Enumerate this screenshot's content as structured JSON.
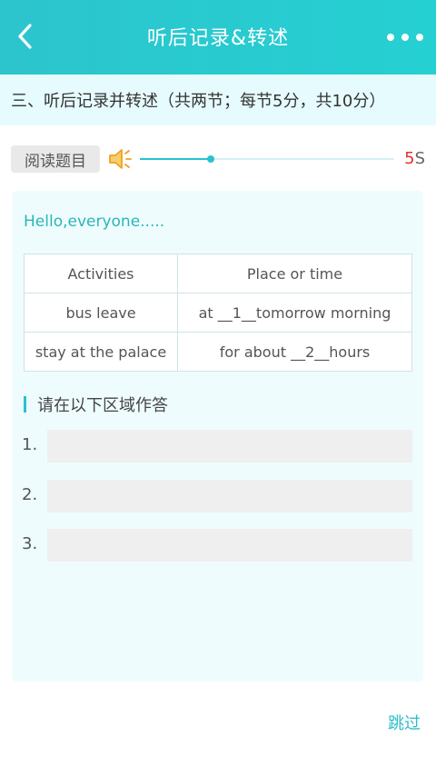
{
  "header": {
    "title": "听后记录&转述",
    "back_icon": "chevron-left-icon",
    "more_icon": "more-dots-icon",
    "gradient": [
      "#2cc4cd",
      "#25d0d3"
    ]
  },
  "section": {
    "heading": "三、听后记录并转述（共两节；每节5分，共10分）"
  },
  "audio": {
    "read_button_label": "阅读题目",
    "speaker_icon": "speaker-icon",
    "progress": 0.28,
    "timer_number": "5",
    "timer_unit": "S",
    "accent_color": "#27c3cf",
    "timer_color": "#e5302c"
  },
  "passage": {
    "greeting": "Hello,everyone.....",
    "table": {
      "headers": [
        "Activities",
        "Place or time"
      ],
      "rows": [
        [
          "bus leave",
          "at __1__tomorrow morning"
        ],
        [
          "stay at the palace",
          "for about __2__hours"
        ]
      ]
    }
  },
  "answers": {
    "title": "请在以下区域作答",
    "items": [
      {
        "number": "1.",
        "value": ""
      },
      {
        "number": "2.",
        "value": ""
      },
      {
        "number": "3.",
        "value": ""
      }
    ]
  },
  "footer": {
    "skip_label": "跳过"
  }
}
